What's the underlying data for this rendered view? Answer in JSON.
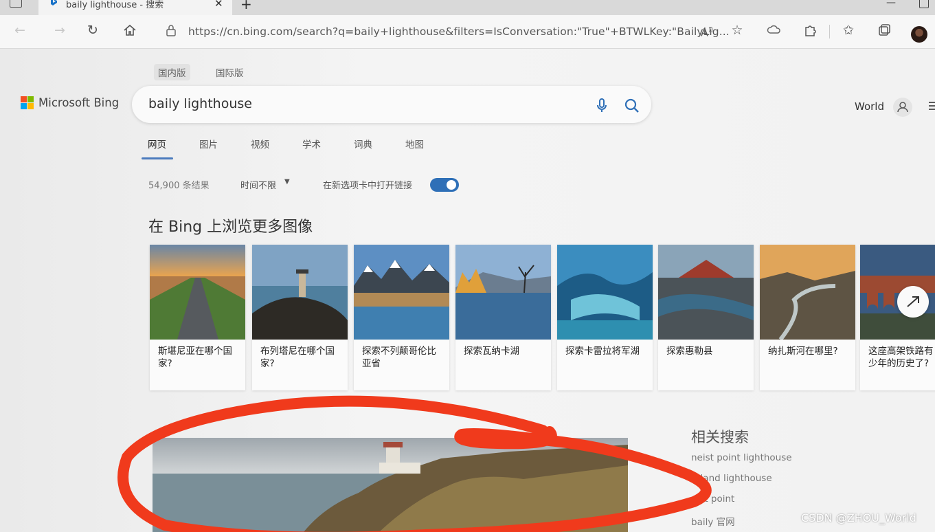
{
  "browser": {
    "tab_title": "baily lighthouse - 搜索",
    "url": "https://cn.bing.com/search?q=baily+lighthouse&filters=IsConversation:\"True\"+BTWLKey:\"BailyLig...",
    "icons": [
      "back-icon",
      "forward-icon",
      "refresh-icon",
      "home-icon",
      "site-info-icon",
      "read-aloud-icon",
      "favorite-add-icon",
      "cloud-icon",
      "extensions-icon",
      "favorites-icon",
      "collections-icon",
      "profile-avatar"
    ]
  },
  "bing": {
    "scopes": [
      "国内版",
      "国际版"
    ],
    "logo_text": "Microsoft Bing",
    "query": "baily lighthouse",
    "region": "World",
    "nav_tabs": [
      "网页",
      "图片",
      "视频",
      "学术",
      "词典",
      "地图"
    ],
    "active_tab": "网页",
    "result_count": "54,900 条结果",
    "time_filter": "时间不限",
    "new_tab_label": "在新选项卡中打开链接",
    "new_tab_toggle_on": true,
    "images_section_title": "在 Bing 上浏览更多图像",
    "image_cards": [
      {
        "caption": "斯堪尼亚在哪个国家?"
      },
      {
        "caption": "布列塔尼在哪个国家?"
      },
      {
        "caption": "探索不列颠哥伦比亚省"
      },
      {
        "caption": "探索瓦纳卡湖"
      },
      {
        "caption": "探索卡雷拉将军湖"
      },
      {
        "caption": "探索惠勒县"
      },
      {
        "caption": "纳扎斯河在哪里?"
      },
      {
        "caption": "这座高架铁路有少年的历史了?"
      }
    ],
    "related_title": "相关搜索",
    "related": [
      "neist point lighthouse",
      "reland lighthouse",
      "nist point",
      "baily 官网"
    ]
  },
  "watermark": "CSDN @ZHOU_World",
  "colors": {
    "accent": "#2e6fb7",
    "annotation": "#f03a1c"
  }
}
